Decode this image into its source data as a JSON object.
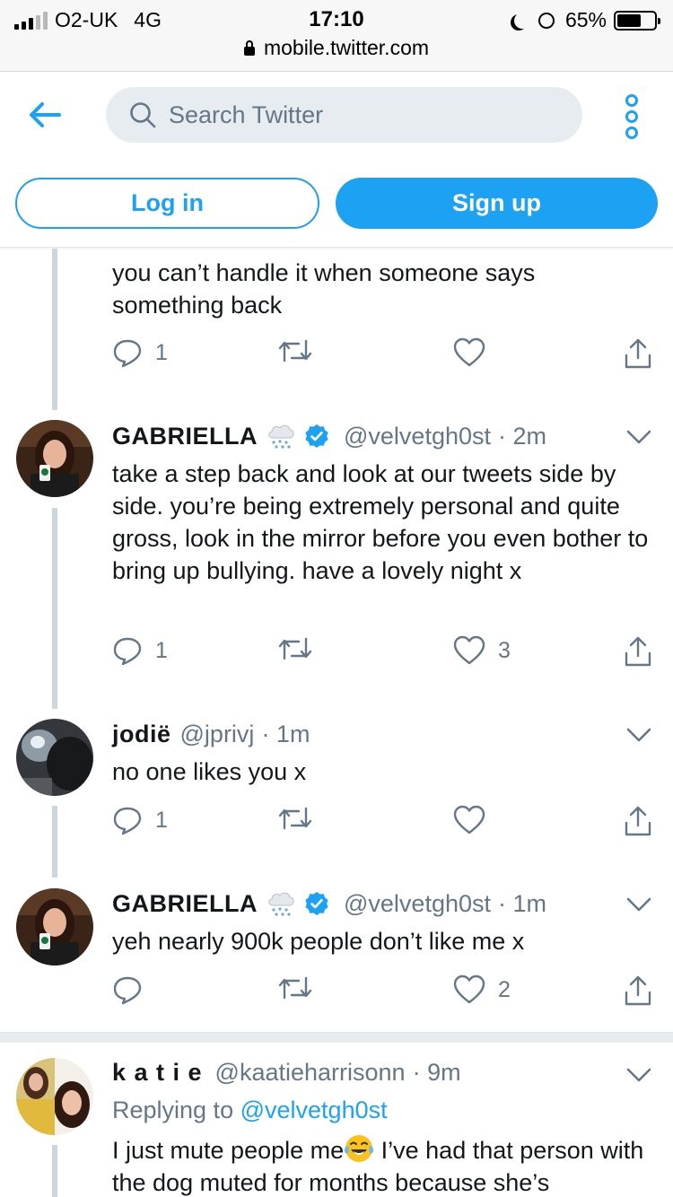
{
  "status_bar": {
    "carrier": "O2-UK",
    "network": "4G",
    "time": "17:10",
    "battery": "65%",
    "battery_level": 0.65,
    "signal_bars_on": 3,
    "signal_bars_total": 5
  },
  "url_bar": {
    "domain": "mobile.twitter.com"
  },
  "header": {
    "search_placeholder": "Search Twitter",
    "login_label": "Log in",
    "signup_label": "Sign up"
  },
  "colors": {
    "brand": "#1da1f2",
    "secondary_text": "#657786",
    "thread_line": "#ccd6dd"
  },
  "tweets": [
    {
      "text": "you can’t handle it when someone says something back",
      "replies": "1",
      "retweets": "",
      "likes": ""
    },
    {
      "name": "GABRIELLA",
      "handle": "@velvetgh0st",
      "time": "· 2m",
      "text": "take a step back and look at our tweets side by side. you’re being extremely personal and quite gross, look in the mirror before you even bother to bring up bullying. have a lovely night x",
      "replies": "1",
      "retweets": "",
      "likes": "3",
      "verified": true,
      "emoji": "cloud-with-snow"
    },
    {
      "name": "jodië",
      "handle": "@jprivj",
      "time": "· 1m",
      "text": "no one likes you x",
      "replies": "1",
      "retweets": "",
      "likes": ""
    },
    {
      "name": "GABRIELLA",
      "handle": "@velvetgh0st",
      "time": "· 1m",
      "text": "yeh nearly 900k people don’t like me x",
      "replies": "",
      "retweets": "",
      "likes": "2",
      "verified": true,
      "emoji": "cloud-with-snow"
    },
    {
      "name": "k a t i e",
      "handle": "@kaatieharrisonn",
      "time": "· 9m",
      "replying_prefix": "Replying to",
      "replying_to": "@velvetgh0st",
      "text_before_emoji": "I just mute people me",
      "text_after_emoji": " I’ve had that person with the dog muted for months because she’s",
      "emoji": "face-with-tears-of-joy"
    }
  ]
}
